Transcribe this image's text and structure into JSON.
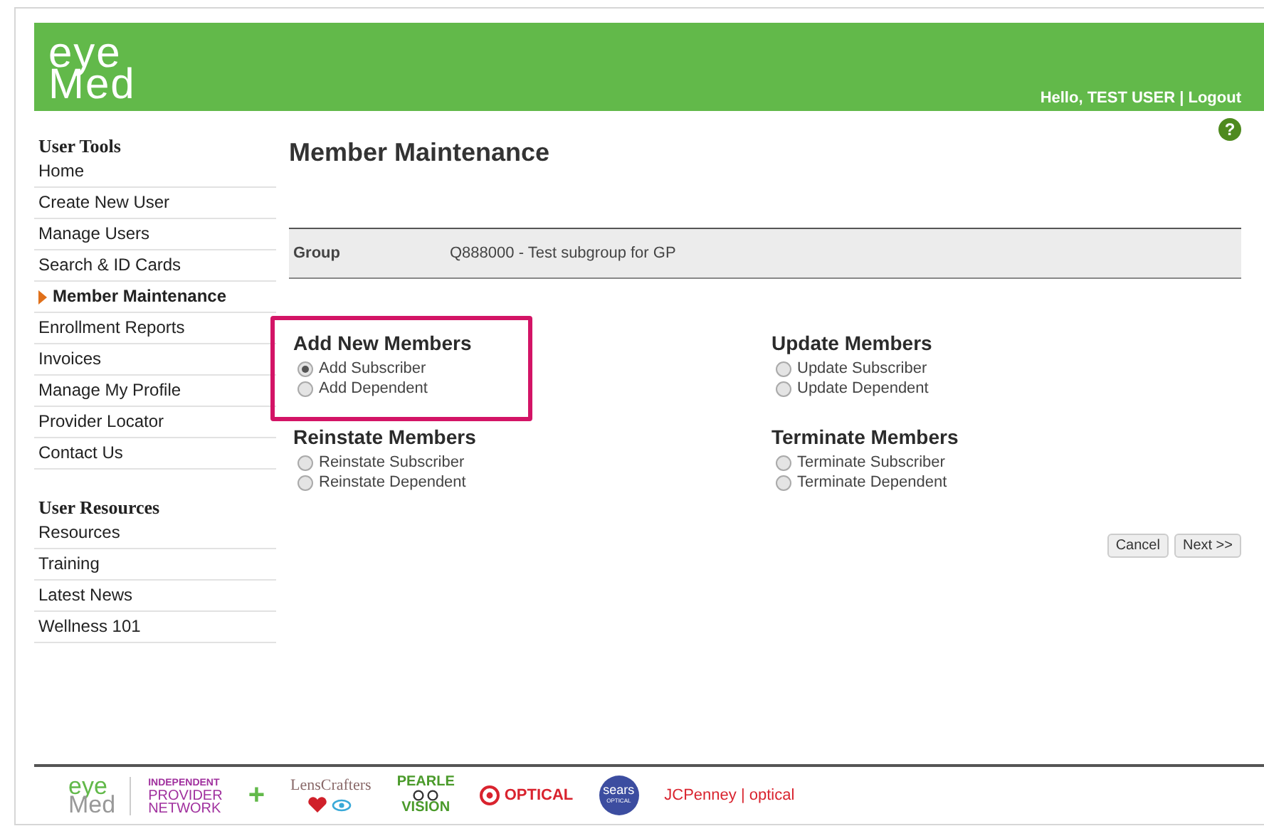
{
  "header": {
    "logo": [
      "eye",
      "Med"
    ],
    "greeting": "Hello, TEST USER | Logout"
  },
  "sidebar": {
    "sections": [
      {
        "title": "User Tools",
        "items": [
          {
            "label": "Home",
            "selected": false
          },
          {
            "label": "Create New User",
            "selected": false
          },
          {
            "label": "Manage Users",
            "selected": false
          },
          {
            "label": "Search & ID Cards",
            "selected": false
          },
          {
            "label": "Member Maintenance",
            "selected": true
          },
          {
            "label": "Enrollment Reports",
            "selected": false
          },
          {
            "label": "Invoices",
            "selected": false
          },
          {
            "label": "Manage My Profile",
            "selected": false
          },
          {
            "label": "Provider Locator",
            "selected": false
          },
          {
            "label": "Contact Us",
            "selected": false
          }
        ]
      },
      {
        "title": "User Resources",
        "items": [
          {
            "label": "Resources",
            "selected": false
          },
          {
            "label": "Training",
            "selected": false
          },
          {
            "label": "Latest News",
            "selected": false
          },
          {
            "label": "Wellness 101",
            "selected": false
          }
        ]
      }
    ]
  },
  "help": "?",
  "page_title": "Member Maintenance",
  "group_bar": {
    "label": "Group",
    "value": "Q888000 - Test subgroup for GP"
  },
  "option_groups": [
    {
      "title": "Add New Members",
      "highlighted": true,
      "options": [
        {
          "label": "Add Subscriber",
          "selected": true
        },
        {
          "label": "Add Dependent",
          "selected": false
        }
      ]
    },
    {
      "title": "Update Members",
      "highlighted": false,
      "options": [
        {
          "label": "Update Subscriber",
          "selected": false
        },
        {
          "label": "Update Dependent",
          "selected": false
        }
      ]
    },
    {
      "title": "Reinstate Members",
      "highlighted": false,
      "options": [
        {
          "label": "Reinstate Subscriber",
          "selected": false
        },
        {
          "label": "Reinstate Dependent",
          "selected": false
        }
      ]
    },
    {
      "title": "Terminate Members",
      "highlighted": false,
      "options": [
        {
          "label": "Terminate Subscriber",
          "selected": false
        },
        {
          "label": "Terminate Dependent",
          "selected": false
        }
      ]
    }
  ],
  "buttons": [
    "Cancel",
    "Next >>"
  ],
  "footer": {
    "logos": [
      {
        "kind": "eyemed",
        "texts": [
          "eye",
          "Med"
        ]
      },
      {
        "kind": "ipn",
        "texts": [
          "INDEPENDENT",
          "PROVIDER",
          "NETWORK"
        ]
      },
      {
        "kind": "plus",
        "texts": [
          "+"
        ]
      },
      {
        "kind": "lenscrafters",
        "texts": [
          "LensCrafters"
        ]
      },
      {
        "kind": "pearle",
        "texts": [
          "PEARLE",
          "VISION"
        ]
      },
      {
        "kind": "target",
        "texts": [
          "OPTICAL"
        ]
      },
      {
        "kind": "sears",
        "texts": [
          "sears",
          "OPTICAL"
        ]
      },
      {
        "kind": "jcp",
        "texts": [
          "JCPenney | optical"
        ]
      }
    ]
  }
}
